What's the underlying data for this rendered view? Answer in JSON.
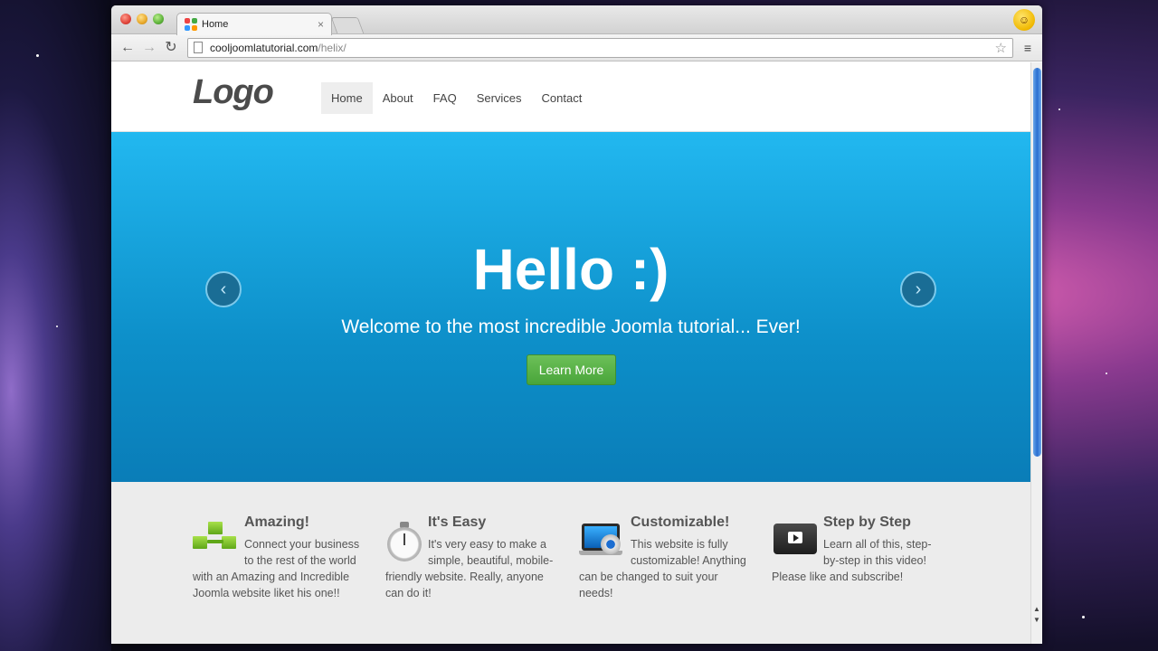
{
  "browser": {
    "tab_title": "Home",
    "tab_close": "×",
    "url_host": "cooljoomlatutorial.com",
    "url_path": "/helix/",
    "icons": [
      "back-icon",
      "forward-icon",
      "reload-icon",
      "bookmark-star-icon",
      "menu-icon",
      "profile-smiley-icon"
    ]
  },
  "site": {
    "logo": "Logo",
    "nav": [
      "Home",
      "About",
      "FAQ",
      "Services",
      "Contact"
    ],
    "active_nav": "Home"
  },
  "hero": {
    "title": "Hello :)",
    "subtitle": "Welcome to the most incredible Joomla tutorial... Ever!",
    "button": "Learn More",
    "prev": "‹",
    "next": "›",
    "colors": {
      "top": "#22b8f0",
      "bottom": "#0a7db8",
      "button": "#49a53a"
    }
  },
  "features": [
    {
      "title": "Amazing!",
      "text": "Connect your business to the rest of the world with an Amazing and Incredible Joomla website liket his one!!"
    },
    {
      "title": "It's Easy",
      "text": "It's very easy to make a simple, beautiful, mobile-friendly website. Really, anyone can do it!"
    },
    {
      "title": "Customizable!",
      "text": "This website is fully customizable! Anything can be changed to suit your needs!"
    },
    {
      "title": "Step by Step",
      "text": "Learn all of this, step-by-step in this video! Please like and subscribe!"
    }
  ]
}
